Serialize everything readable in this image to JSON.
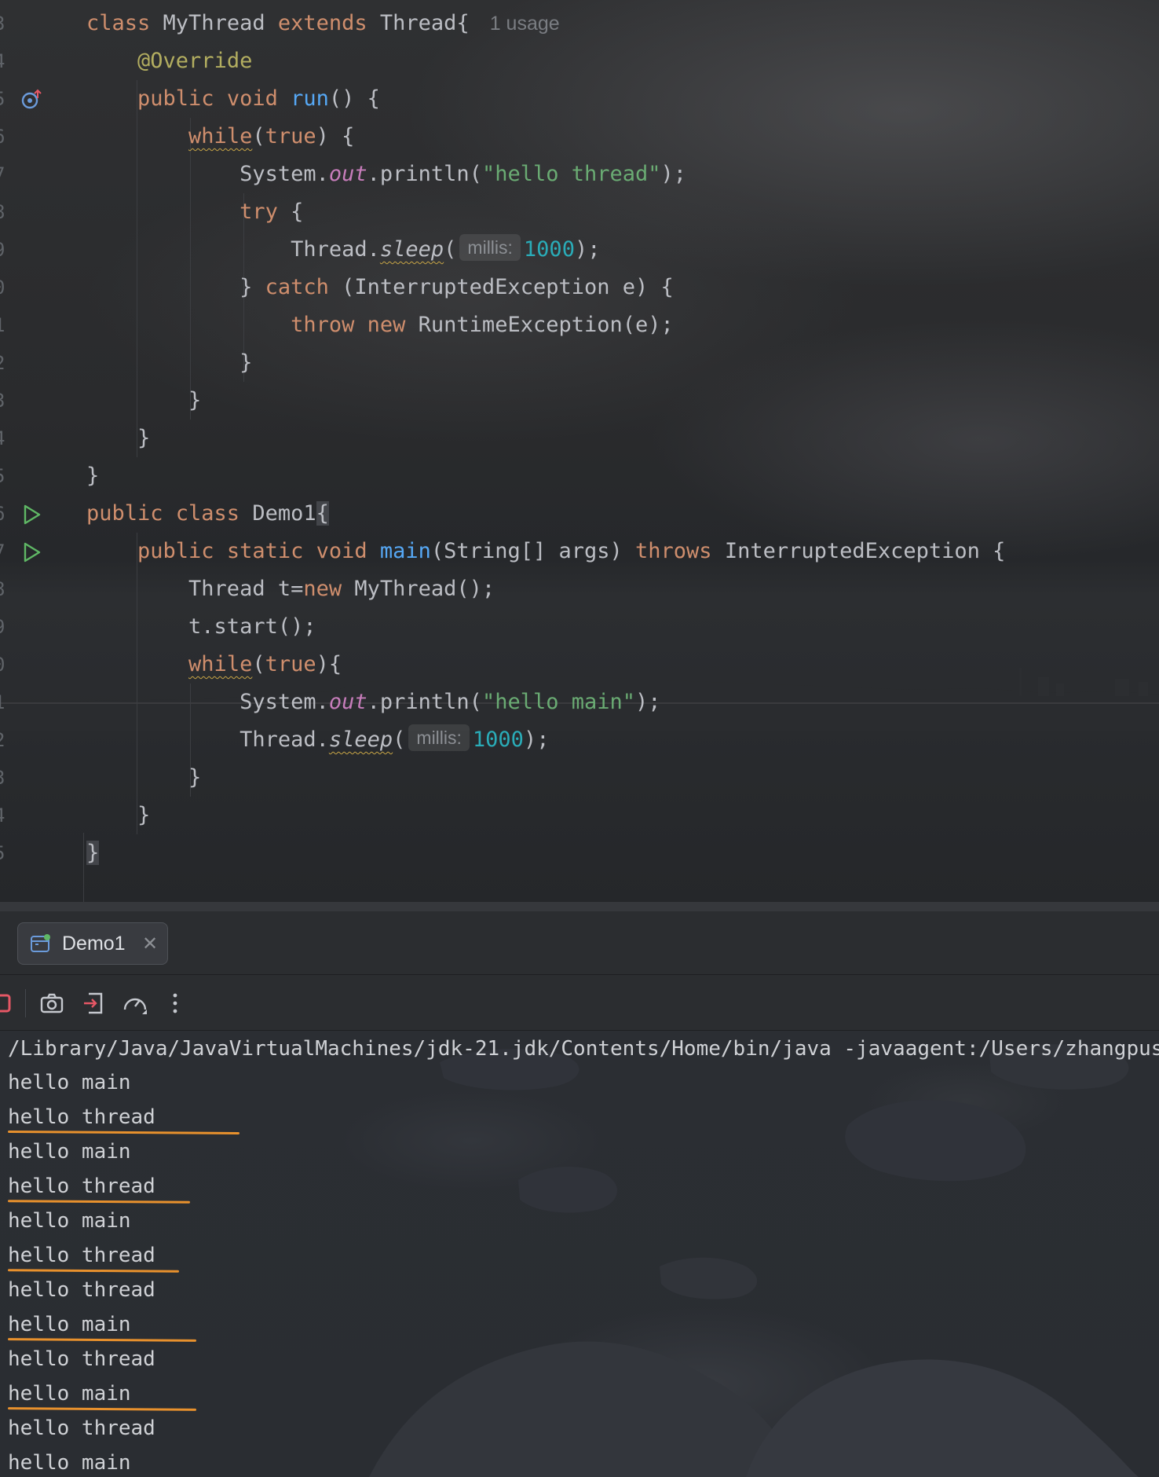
{
  "editor": {
    "lines": [
      {
        "num": "3",
        "code": [
          {
            "t": "class ",
            "c": "kw"
          },
          {
            "t": "MyThread "
          },
          {
            "t": "extends ",
            "c": "kw"
          },
          {
            "t": "Thread{"
          },
          {
            "t": "1 usage",
            "c": "usage"
          }
        ]
      },
      {
        "num": "4",
        "code": [
          {
            "t": "    "
          },
          {
            "t": "@Override",
            "c": "an"
          }
        ]
      },
      {
        "num": "5",
        "icon": "override-marker-icon",
        "code": [
          {
            "t": "    "
          },
          {
            "t": "public void ",
            "c": "kw"
          },
          {
            "t": "run",
            "c": "fn"
          },
          {
            "t": "() {"
          }
        ]
      },
      {
        "num": "6",
        "code": [
          {
            "t": "        "
          },
          {
            "t": "while",
            "c": "kw wv"
          },
          {
            "t": "("
          },
          {
            "t": "true",
            "c": "kw"
          },
          {
            "t": ") {"
          }
        ]
      },
      {
        "num": "7",
        "code": [
          {
            "t": "            System."
          },
          {
            "t": "out",
            "c": "sf"
          },
          {
            "t": ".println("
          },
          {
            "t": "\"hello thread\"",
            "c": "st"
          },
          {
            "t": ");"
          }
        ]
      },
      {
        "num": "8",
        "code": [
          {
            "t": "            "
          },
          {
            "t": "try",
            "c": "kw"
          },
          {
            "t": " {"
          }
        ]
      },
      {
        "num": "9",
        "code": [
          {
            "t": "                Thread."
          },
          {
            "t": "sleep",
            "c": "it wv"
          },
          {
            "t": "("
          },
          {
            "t": "millis:",
            "c": "hint"
          },
          {
            "t": "1000",
            "c": "nm"
          },
          {
            "t": ");"
          }
        ]
      },
      {
        "num": "0",
        "code": [
          {
            "t": "            } "
          },
          {
            "t": "catch",
            "c": "kw"
          },
          {
            "t": " (InterruptedException e) {"
          }
        ]
      },
      {
        "num": "1",
        "code": [
          {
            "t": "                "
          },
          {
            "t": "throw new ",
            "c": "kw"
          },
          {
            "t": "RuntimeException(e);"
          }
        ]
      },
      {
        "num": "2",
        "code": [
          {
            "t": "            }"
          }
        ]
      },
      {
        "num": "3",
        "code": [
          {
            "t": "        }"
          }
        ]
      },
      {
        "num": "4",
        "code": [
          {
            "t": "    }"
          }
        ]
      },
      {
        "num": "5",
        "code": [
          {
            "t": "}"
          }
        ]
      },
      {
        "num": "6",
        "icon": "run-icon",
        "code": [
          {
            "t": "public class ",
            "c": "kw"
          },
          {
            "t": "Demo1"
          },
          {
            "t": "{",
            "c": "caret-box"
          }
        ]
      },
      {
        "num": "7",
        "icon": "run-icon",
        "code": [
          {
            "t": "    "
          },
          {
            "t": "public static void ",
            "c": "kw"
          },
          {
            "t": "main",
            "c": "fn"
          },
          {
            "t": "(String[] args) "
          },
          {
            "t": "throws ",
            "c": "kw"
          },
          {
            "t": "InterruptedException {"
          }
        ]
      },
      {
        "num": "8",
        "code": [
          {
            "t": "        Thread t="
          },
          {
            "t": "new ",
            "c": "kw"
          },
          {
            "t": "MyThread();"
          }
        ]
      },
      {
        "num": "9",
        "code": [
          {
            "t": "        t.start();"
          }
        ]
      },
      {
        "num": "0",
        "code": [
          {
            "t": "        "
          },
          {
            "t": "while",
            "c": "kw wv"
          },
          {
            "t": "("
          },
          {
            "t": "true",
            "c": "kw"
          },
          {
            "t": "){"
          }
        ]
      },
      {
        "num": "1",
        "code": [
          {
            "t": "            System."
          },
          {
            "t": "out",
            "c": "sf"
          },
          {
            "t": ".println("
          },
          {
            "t": "\"hello main\"",
            "c": "st"
          },
          {
            "t": ");"
          }
        ]
      },
      {
        "num": "2",
        "code": [
          {
            "t": "            Thread."
          },
          {
            "t": "sleep",
            "c": "it wv"
          },
          {
            "t": "("
          },
          {
            "t": "millis:",
            "c": "hint"
          },
          {
            "t": "1000",
            "c": "nm"
          },
          {
            "t": ");"
          }
        ]
      },
      {
        "num": "3",
        "code": [
          {
            "t": "        }"
          }
        ]
      },
      {
        "num": "4",
        "code": [
          {
            "t": "    }"
          }
        ]
      },
      {
        "num": "5",
        "code": [
          {
            "t": "}",
            "c": "caret-box"
          }
        ]
      }
    ]
  },
  "run_tab": {
    "label": "Demo1",
    "close_icon": "close-icon",
    "icon": "run-config-icon"
  },
  "toolbar": {
    "icons": [
      "stop-icon",
      "screenshot-camera-icon",
      "exit-icon",
      "profiler-gauge-icon",
      "more-vertical-icon"
    ]
  },
  "console": {
    "command": "/Library/Java/JavaVirtualMachines/jdk-21.jdk/Contents/Home/bin/java -javaagent:/Users/zhangpus",
    "output": [
      {
        "text": "hello main",
        "underlined": false
      },
      {
        "text": "hello thread",
        "underlined": true
      },
      {
        "text": "hello main",
        "underlined": false
      },
      {
        "text": "hello thread",
        "underlined": true
      },
      {
        "text": "hello main",
        "underlined": false
      },
      {
        "text": "hello thread",
        "underlined": true
      },
      {
        "text": "hello thread",
        "underlined": false
      },
      {
        "text": "hello main",
        "underlined": true
      },
      {
        "text": "hello thread",
        "underlined": false
      },
      {
        "text": "hello main",
        "underlined": true
      },
      {
        "text": "hello thread",
        "underlined": false
      },
      {
        "text": "hello main",
        "underlined": false
      }
    ],
    "underline_color": "#e8912d"
  },
  "colors": {
    "keyword": "#cf8e6d",
    "function": "#56a8f5",
    "string": "#6aab73",
    "number": "#2aacb8",
    "annotation": "#b3ae60",
    "static_field": "#c77dbb",
    "run_green": "#5fb865"
  }
}
